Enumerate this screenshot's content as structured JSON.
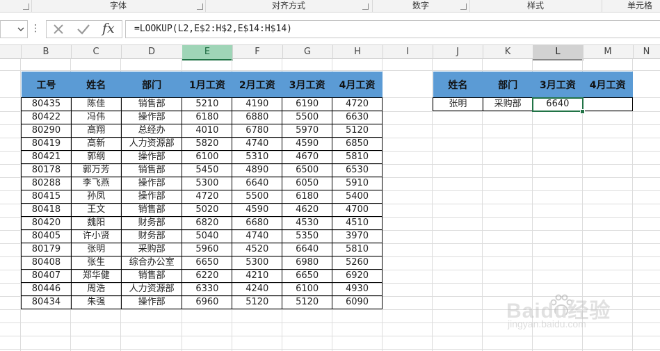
{
  "ribbon": {
    "groups": [
      {
        "label": "字体"
      },
      {
        "label": "对齐方式"
      },
      {
        "label": "数字"
      },
      {
        "label": "样式"
      },
      {
        "label": "单元格"
      }
    ]
  },
  "formula_bar": {
    "formula": "=LOOKUP(L2,E$2:H$2,E$14:H$14)",
    "fx_label": "fx",
    "more_label": "⋮"
  },
  "columns": [
    "B",
    "C",
    "D",
    "E",
    "F",
    "G",
    "H",
    "I",
    "J",
    "K",
    "L",
    "M",
    "N"
  ],
  "main_table": {
    "headers": [
      "工号",
      "姓名",
      "部门",
      "1月工资",
      "2月工资",
      "3月工资",
      "4月工资"
    ],
    "rows": [
      [
        "80435",
        "陈佳",
        "销售部",
        "5210",
        "4190",
        "6190",
        "4720"
      ],
      [
        "80422",
        "冯伟",
        "操作部",
        "6180",
        "6880",
        "5500",
        "6630"
      ],
      [
        "80290",
        "高翔",
        "总经办",
        "4010",
        "6780",
        "5970",
        "5120"
      ],
      [
        "80419",
        "高新",
        "人力资源部",
        "5820",
        "4740",
        "4590",
        "6850"
      ],
      [
        "80421",
        "郭纲",
        "操作部",
        "6100",
        "5310",
        "4670",
        "5810"
      ],
      [
        "80178",
        "郭万芳",
        "销售部",
        "5450",
        "4890",
        "6500",
        "6530"
      ],
      [
        "80288",
        "李飞燕",
        "操作部",
        "5300",
        "6640",
        "6050",
        "5910"
      ],
      [
        "80415",
        "孙凤",
        "操作部",
        "4720",
        "5500",
        "6180",
        "5400"
      ],
      [
        "80418",
        "王文",
        "销售部",
        "5020",
        "4590",
        "4620",
        "4700"
      ],
      [
        "80420",
        "魏阳",
        "财务部",
        "6820",
        "6680",
        "4530",
        "4510"
      ],
      [
        "80405",
        "许小贤",
        "财务部",
        "5040",
        "4740",
        "5350",
        "3970"
      ],
      [
        "80179",
        "张明",
        "采购部",
        "5960",
        "4520",
        "6640",
        "5810"
      ],
      [
        "80408",
        "张生",
        "综合办公室",
        "6650",
        "5300",
        "6980",
        "5260"
      ],
      [
        "80407",
        "郑华健",
        "销售部",
        "6220",
        "4210",
        "6650",
        "6920"
      ],
      [
        "80446",
        "周浩",
        "人力资源部",
        "6330",
        "4240",
        "6100",
        "4930"
      ],
      [
        "80434",
        "朱强",
        "操作部",
        "6960",
        "5120",
        "5120",
        "6090"
      ]
    ]
  },
  "lookup_table": {
    "headers": [
      "姓名",
      "部门",
      "3月工资",
      "4月工资"
    ],
    "row": [
      "张明",
      "采购部",
      "6640",
      ""
    ]
  },
  "watermark": {
    "brand": "Baidu经验",
    "url": "jingyan.baidu.com"
  },
  "colors": {
    "header_blue": "#5b9bd5",
    "excel_green": "#217346"
  }
}
